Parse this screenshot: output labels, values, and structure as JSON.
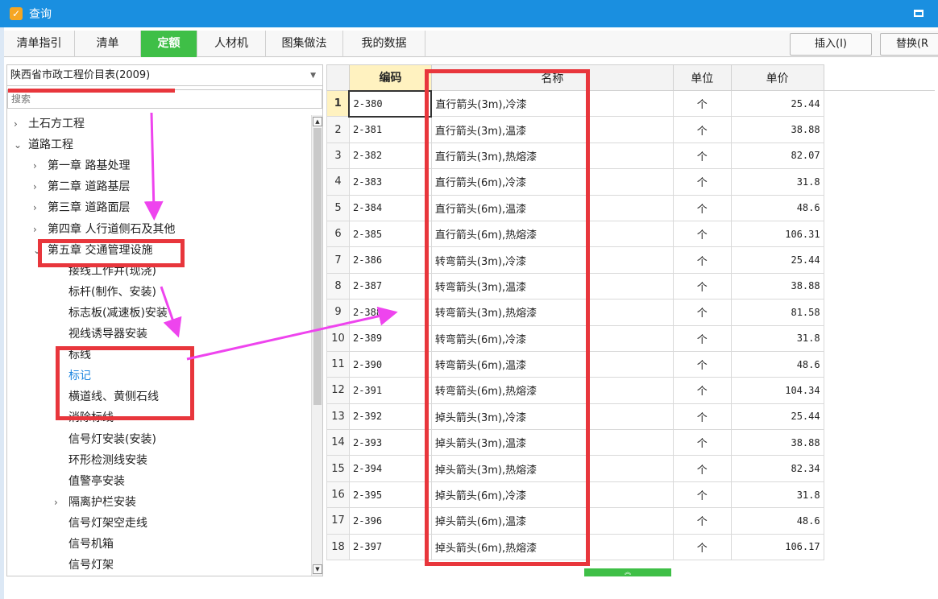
{
  "window": {
    "title": "查询",
    "app_icon": "app-logo-icon",
    "accent": "#1a8fe0"
  },
  "tabs": [
    {
      "label": "清单指引",
      "active": false
    },
    {
      "label": "清单",
      "active": false
    },
    {
      "label": "定额",
      "active": true
    },
    {
      "label": "人材机",
      "active": false
    },
    {
      "label": "图集做法",
      "active": false
    },
    {
      "label": "我的数据",
      "active": false
    }
  ],
  "toolbar": {
    "insert_label": "插入(I)",
    "replace_label": "替换(R"
  },
  "left": {
    "library": "陕西省市政工程价目表(2009)",
    "search_placeholder": "搜索",
    "tree": [
      {
        "label": "土石方工程",
        "arrow": "›"
      },
      {
        "label": "道路工程",
        "arrow": "⌄"
      },
      {
        "label": "第一章 路基处理",
        "arrow": "›"
      },
      {
        "label": "第二章 道路基层",
        "arrow": "›"
      },
      {
        "label": "第三章 道路面层",
        "arrow": "›"
      },
      {
        "label": "第四章 人行道侧石及其他",
        "arrow": "›"
      },
      {
        "label": "第五章 交通管理设施",
        "arrow": "⌄"
      },
      {
        "label": "接线工作井(现浇)",
        "arrow": ""
      },
      {
        "label": "标杆(制作、安装)",
        "arrow": ""
      },
      {
        "label": "标志板(减速板)安装",
        "arrow": ""
      },
      {
        "label": "视线诱导器安装",
        "arrow": ""
      },
      {
        "label": "标线",
        "arrow": ""
      },
      {
        "label": "标记",
        "arrow": ""
      },
      {
        "label": "横道线、黄侧石线",
        "arrow": ""
      },
      {
        "label": "消除标线",
        "arrow": ""
      },
      {
        "label": "信号灯安装(安装)",
        "arrow": ""
      },
      {
        "label": "环形检测线安装",
        "arrow": ""
      },
      {
        "label": "值警亭安装",
        "arrow": ""
      },
      {
        "label": "隔离护栏安装",
        "arrow": "›"
      },
      {
        "label": "信号灯架空走线",
        "arrow": ""
      },
      {
        "label": "信号机箱",
        "arrow": ""
      },
      {
        "label": "信号灯架",
        "arrow": ""
      }
    ]
  },
  "grid": {
    "columns": [
      "编码",
      "名称",
      "单位",
      "单价"
    ],
    "rows": [
      {
        "no": "1",
        "code": "2-380",
        "name": "直行箭头(3m),冷漆",
        "unit": "个",
        "price": "25.44"
      },
      {
        "no": "2",
        "code": "2-381",
        "name": "直行箭头(3m),温漆",
        "unit": "个",
        "price": "38.88"
      },
      {
        "no": "3",
        "code": "2-382",
        "name": "直行箭头(3m),热熔漆",
        "unit": "个",
        "price": "82.07"
      },
      {
        "no": "4",
        "code": "2-383",
        "name": "直行箭头(6m),冷漆",
        "unit": "个",
        "price": "31.8"
      },
      {
        "no": "5",
        "code": "2-384",
        "name": "直行箭头(6m),温漆",
        "unit": "个",
        "price": "48.6"
      },
      {
        "no": "6",
        "code": "2-385",
        "name": "直行箭头(6m),热熔漆",
        "unit": "个",
        "price": "106.31"
      },
      {
        "no": "7",
        "code": "2-386",
        "name": "转弯箭头(3m),冷漆",
        "unit": "个",
        "price": "25.44"
      },
      {
        "no": "8",
        "code": "2-387",
        "name": "转弯箭头(3m),温漆",
        "unit": "个",
        "price": "38.88"
      },
      {
        "no": "9",
        "code": "2-388",
        "name": "转弯箭头(3m),热熔漆",
        "unit": "个",
        "price": "81.58"
      },
      {
        "no": "10",
        "code": "2-389",
        "name": "转弯箭头(6m),冷漆",
        "unit": "个",
        "price": "31.8"
      },
      {
        "no": "11",
        "code": "2-390",
        "name": "转弯箭头(6m),温漆",
        "unit": "个",
        "price": "48.6"
      },
      {
        "no": "12",
        "code": "2-391",
        "name": "转弯箭头(6m),热熔漆",
        "unit": "个",
        "price": "104.34"
      },
      {
        "no": "13",
        "code": "2-392",
        "name": "掉头箭头(3m),冷漆",
        "unit": "个",
        "price": "25.44"
      },
      {
        "no": "14",
        "code": "2-393",
        "name": "掉头箭头(3m),温漆",
        "unit": "个",
        "price": "38.88"
      },
      {
        "no": "15",
        "code": "2-394",
        "name": "掉头箭头(3m),热熔漆",
        "unit": "个",
        "price": "82.34"
      },
      {
        "no": "16",
        "code": "2-395",
        "name": "掉头箭头(6m),冷漆",
        "unit": "个",
        "price": "31.8"
      },
      {
        "no": "17",
        "code": "2-396",
        "name": "掉头箭头(6m),温漆",
        "unit": "个",
        "price": "48.6"
      },
      {
        "no": "18",
        "code": "2-397",
        "name": "掉头箭头(6m),热熔漆",
        "unit": "个",
        "price": "106.17"
      }
    ]
  },
  "colors": {
    "active_tab": "#3fbf47",
    "annotation_red": "#e8363c",
    "annotation_arrow": "#ee44ee",
    "link_blue": "#1f86e0"
  }
}
